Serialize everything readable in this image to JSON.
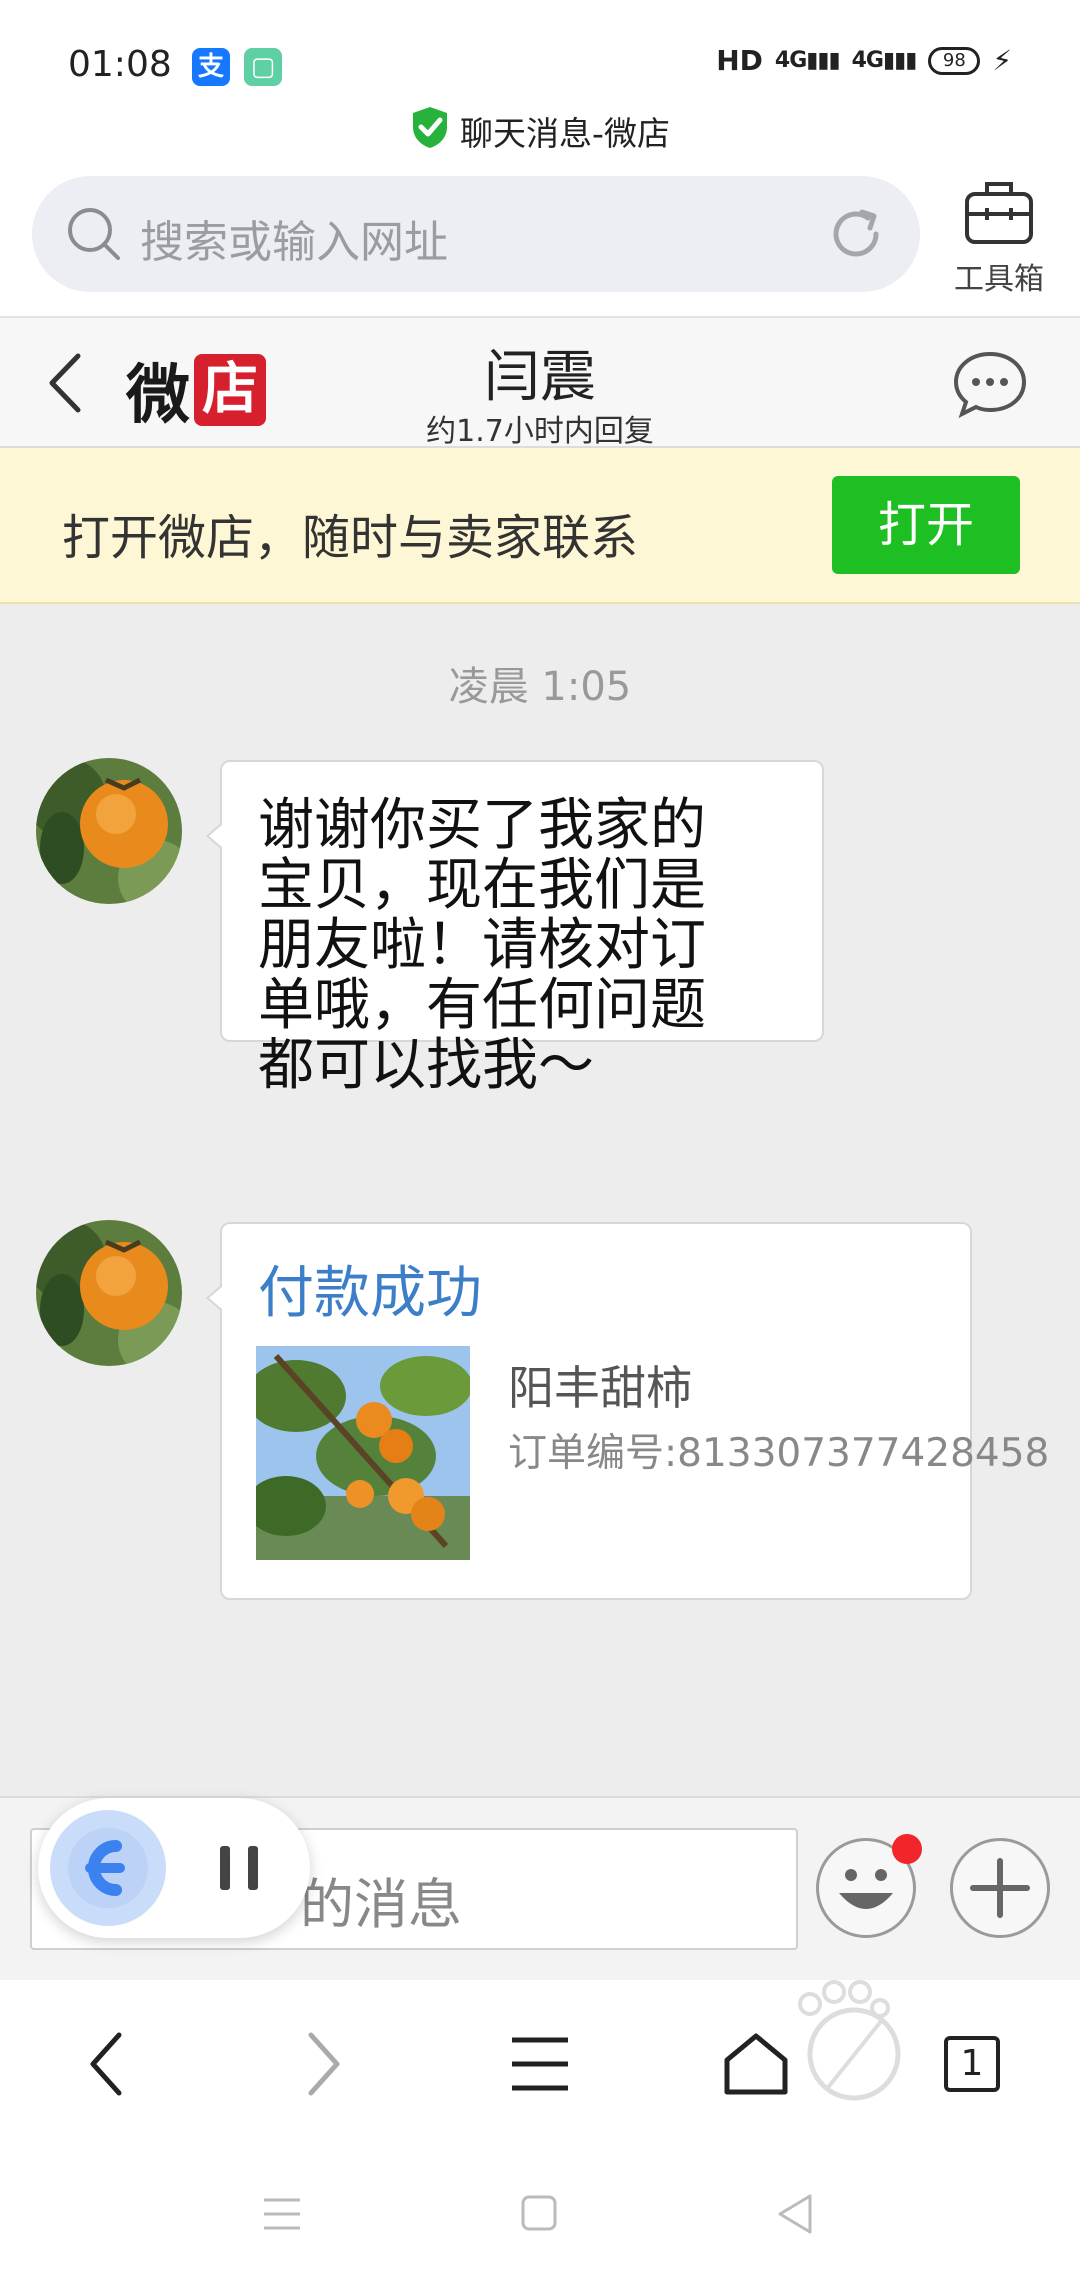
{
  "status_bar": {
    "time": "01:08",
    "app_icons": [
      "alipay-icon",
      "app-icon"
    ],
    "network": "HD",
    "signal_1": "4G",
    "signal_2": "4G",
    "battery": "98",
    "charging_icon": "lightning-icon"
  },
  "page": {
    "title": "聊天消息-微店",
    "secure_icon": "shield-check-icon"
  },
  "search": {
    "placeholder": "搜索或输入网址"
  },
  "toolbox": {
    "label": "工具箱",
    "icon": "toolbox-icon"
  },
  "chat_header": {
    "logo_part1": "微",
    "logo_part2": "店",
    "seller_name": "闫震",
    "reply_time": "约1.7小时内回复"
  },
  "banner": {
    "text": "打开微店，随时与卖家联系",
    "button_label": "打开"
  },
  "chat": {
    "timestamp": "凌晨 1:05",
    "messages": [
      {
        "type": "text",
        "lines": [
          "谢谢你买了我家的",
          "宝贝，现在我们是",
          "朋友啦！请核对订",
          "单哦，有任何问题",
          "都可以找我～"
        ]
      },
      {
        "type": "order",
        "title": "付款成功",
        "product_name": "阳丰甜柿",
        "order_number": "订单编号:813307377428458"
      }
    ]
  },
  "input": {
    "placeholder": "的消息"
  },
  "colors": {
    "accent_green": "#1ebf22",
    "banner_bg": "#fdf7d5",
    "pay_title_blue": "#3d7ec9",
    "logo_red": "#d6202e",
    "chat_bg": "#ededed"
  }
}
